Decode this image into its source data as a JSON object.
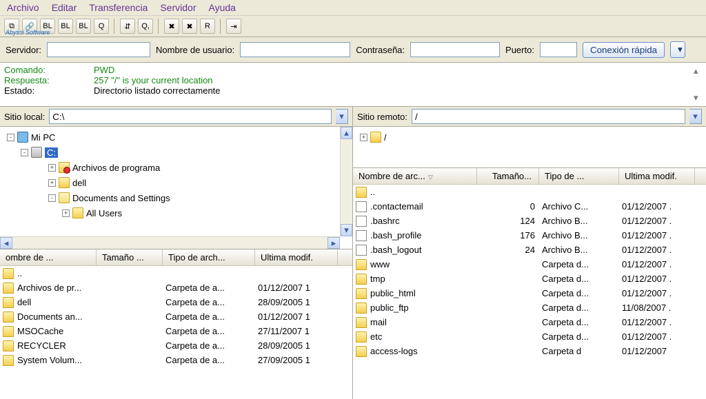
{
  "menu": {
    "items": [
      "Archivo",
      "Editar",
      "Transferencia",
      "Servidor",
      "Ayuda"
    ]
  },
  "toolbar": {
    "buttons": [
      "⧉",
      "🔗",
      "BL",
      "BL",
      "BL",
      "Q",
      "⇵",
      "Q,",
      "✖",
      "✖",
      "R",
      "⇥"
    ]
  },
  "quickconnect": {
    "server_label": "Servidor:",
    "user_label": "Nombre de usuario:",
    "pass_label": "Contraseña:",
    "port_label": "Puerto:",
    "connect_label": "Conexión rápida"
  },
  "log": {
    "lines": [
      {
        "label": "Comando:",
        "text": "PWD",
        "cls": "green"
      },
      {
        "label": "Respuesta:",
        "text": "257 \"/\" is your current location",
        "cls": "green"
      },
      {
        "label": "Estado:",
        "text": "Directorio listado correctamente",
        "cls": ""
      }
    ]
  },
  "local": {
    "path_label": "Sitio local:",
    "path_value": "C:\\",
    "tree": {
      "root": "Mi PC",
      "drive": "C:",
      "nodes": [
        {
          "exp": "+",
          "icon": "special",
          "label": "Archivos de programa",
          "indent": 3
        },
        {
          "exp": "+",
          "icon": "folder",
          "label": "dell",
          "indent": 3
        },
        {
          "exp": "-",
          "icon": "folderopen",
          "label": "Documents and Settings",
          "indent": 3
        },
        {
          "exp": "+",
          "icon": "folder",
          "label": "All Users",
          "indent": 4
        }
      ]
    },
    "columns": [
      "ombre de ...",
      "Tamaño ...",
      "Tipo de arch...",
      "Ultima modif."
    ],
    "rows": [
      {
        "icon": "folder",
        "name": "..",
        "size": "",
        "type": "",
        "mod": ""
      },
      {
        "icon": "folder",
        "name": "Archivos de pr...",
        "size": "",
        "type": "Carpeta de a...",
        "mod": "01/12/2007 1"
      },
      {
        "icon": "folder",
        "name": "dell",
        "size": "",
        "type": "Carpeta de a...",
        "mod": "28/09/2005 1"
      },
      {
        "icon": "folder",
        "name": "Documents an...",
        "size": "",
        "type": "Carpeta de a...",
        "mod": "01/12/2007 1"
      },
      {
        "icon": "folder",
        "name": "MSOCache",
        "size": "",
        "type": "Carpeta de a...",
        "mod": "27/11/2007 1"
      },
      {
        "icon": "folder",
        "name": "RECYCLER",
        "size": "",
        "type": "Carpeta de a...",
        "mod": "28/09/2005 1"
      },
      {
        "icon": "folder",
        "name": "System Volum...",
        "size": "",
        "type": "Carpeta de a...",
        "mod": "27/09/2005 1"
      }
    ]
  },
  "remote": {
    "path_label": "Sitio remoto:",
    "path_value": "/",
    "tree_root": "/",
    "columns": [
      "Nombre de arc...",
      "Tamaño...",
      "Tipo de ...",
      "Ultima modif."
    ],
    "rows": [
      {
        "icon": "folder",
        "name": "..",
        "size": "",
        "type": "",
        "mod": ""
      },
      {
        "icon": "file",
        "name": ".contactemail",
        "size": "0",
        "type": "Archivo C...",
        "mod": "01/12/2007 ."
      },
      {
        "icon": "file",
        "name": ".bashrc",
        "size": "124",
        "type": "Archivo B...",
        "mod": "01/12/2007 ."
      },
      {
        "icon": "file",
        "name": ".bash_profile",
        "size": "176",
        "type": "Archivo B...",
        "mod": "01/12/2007 ."
      },
      {
        "icon": "file",
        "name": ".bash_logout",
        "size": "24",
        "type": "Archivo B...",
        "mod": "01/12/2007 ."
      },
      {
        "icon": "folder",
        "name": "www",
        "size": "",
        "type": "Carpeta d...",
        "mod": "01/12/2007 ."
      },
      {
        "icon": "folder",
        "name": "tmp",
        "size": "",
        "type": "Carpeta d...",
        "mod": "01/12/2007 ."
      },
      {
        "icon": "folder",
        "name": "public_html",
        "size": "",
        "type": "Carpeta d...",
        "mod": "01/12/2007 ."
      },
      {
        "icon": "folder",
        "name": "public_ftp",
        "size": "",
        "type": "Carpeta d...",
        "mod": "11/08/2007 ."
      },
      {
        "icon": "folder",
        "name": "mail",
        "size": "",
        "type": "Carpeta d...",
        "mod": "01/12/2007 ."
      },
      {
        "icon": "folder",
        "name": "etc",
        "size": "",
        "type": "Carpeta d...",
        "mod": "01/12/2007 ."
      },
      {
        "icon": "folder",
        "name": "access-logs",
        "size": "",
        "type": "Carpeta d",
        "mod": "01/12/2007"
      }
    ]
  }
}
